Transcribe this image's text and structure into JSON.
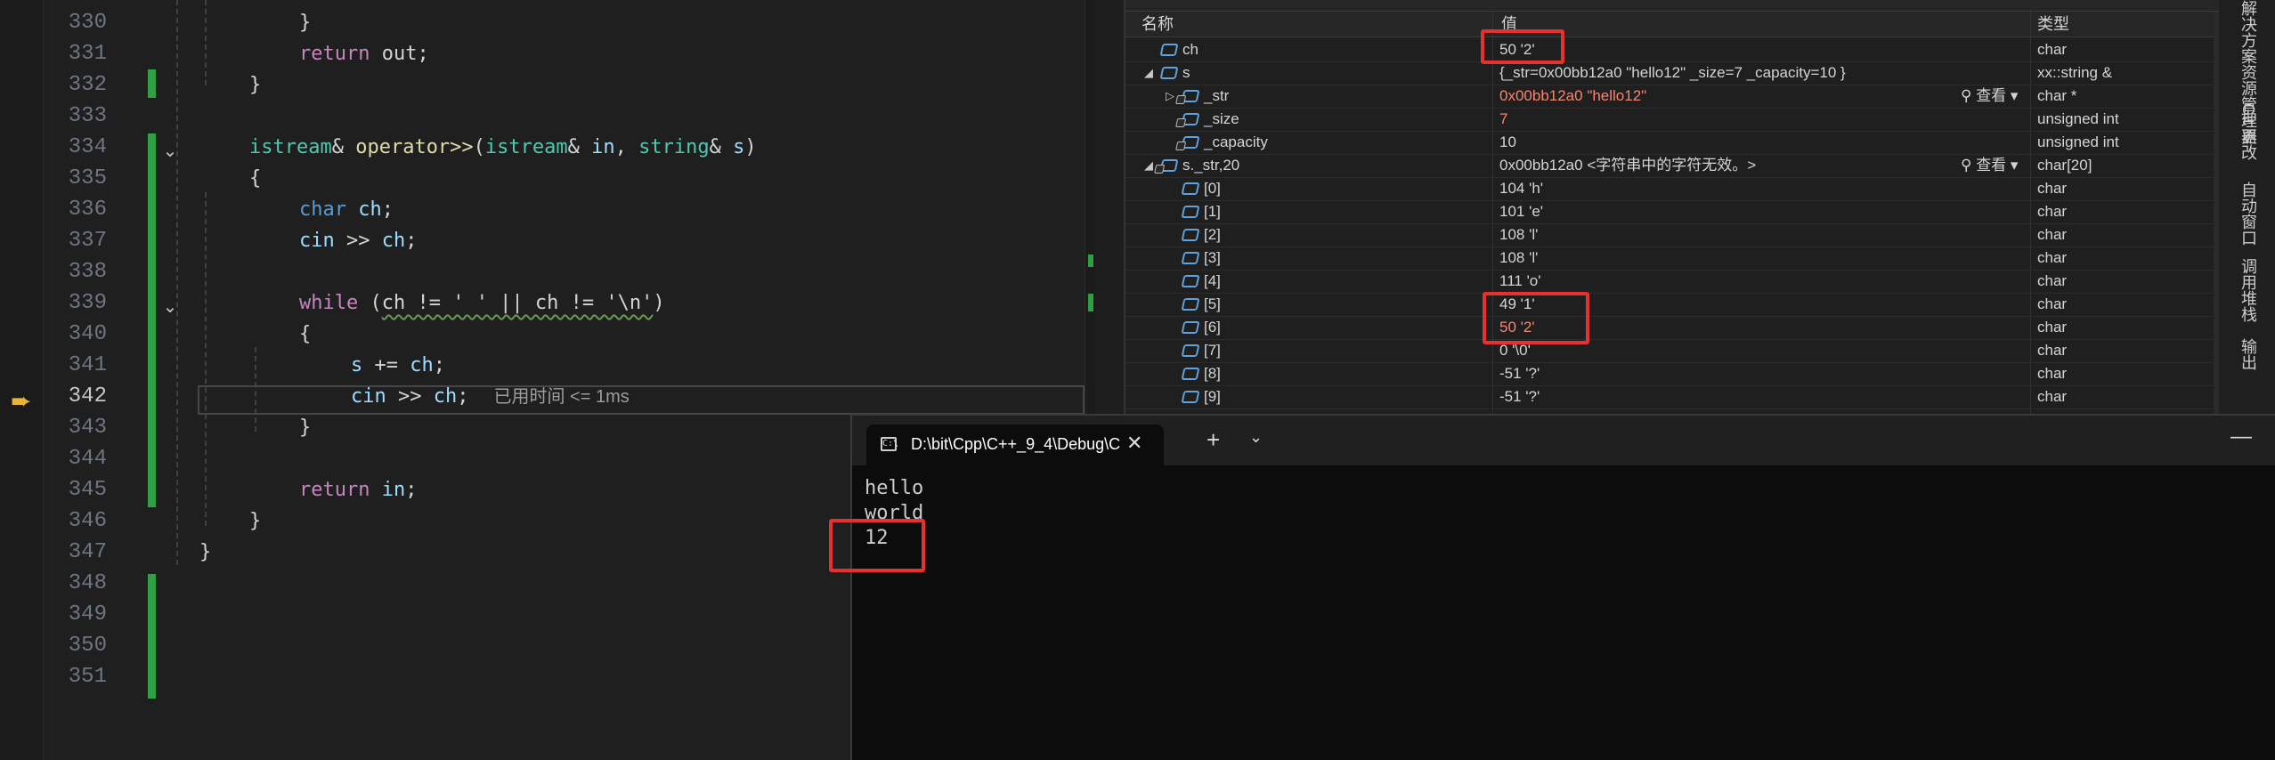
{
  "editor": {
    "lines": [
      {
        "num": "330",
        "tokens": [
          {
            "t": "}",
            "c": ""
          }
        ]
      },
      {
        "num": "331",
        "tokens": [
          {
            "t": "return",
            "c": "kw2"
          },
          {
            "t": " out;",
            "c": ""
          }
        ]
      },
      {
        "num": "332",
        "tokens": [
          {
            "t": "}",
            "c": ""
          }
        ]
      },
      {
        "num": "333",
        "tokens": []
      },
      {
        "num": "334",
        "tokens": [
          {
            "t": "istream",
            "c": "tp"
          },
          {
            "t": "& ",
            "c": ""
          },
          {
            "t": "operator>>",
            "c": "fn"
          },
          {
            "t": "(",
            "c": ""
          },
          {
            "t": "istream",
            "c": "tp"
          },
          {
            "t": "& ",
            "c": ""
          },
          {
            "t": "in",
            "c": "var"
          },
          {
            "t": ", ",
            "c": ""
          },
          {
            "t": "string",
            "c": "tp"
          },
          {
            "t": "& ",
            "c": ""
          },
          {
            "t": "s",
            "c": "var"
          },
          {
            "t": ")",
            "c": ""
          }
        ]
      },
      {
        "num": "335",
        "tokens": [
          {
            "t": "{",
            "c": ""
          }
        ]
      },
      {
        "num": "336",
        "tokens": [
          {
            "t": "char",
            "c": "kw"
          },
          {
            "t": " ",
            "c": ""
          },
          {
            "t": "ch",
            "c": "var"
          },
          {
            "t": ";",
            "c": ""
          }
        ]
      },
      {
        "num": "337",
        "tokens": [
          {
            "t": "cin",
            "c": "var"
          },
          {
            "t": " >> ",
            "c": ""
          },
          {
            "t": "ch",
            "c": "var"
          },
          {
            "t": ";",
            "c": ""
          }
        ]
      },
      {
        "num": "338",
        "tokens": []
      },
      {
        "num": "339",
        "tokens": [
          {
            "t": "while",
            "c": "kw2"
          },
          {
            "t": " (",
            "c": ""
          },
          {
            "t": "ch != ' ' || ch != '\\n'",
            "c": "squig"
          },
          {
            "t": ")",
            "c": ""
          }
        ]
      },
      {
        "num": "340",
        "tokens": [
          {
            "t": "{",
            "c": ""
          }
        ]
      },
      {
        "num": "341",
        "tokens": [
          {
            "t": "s",
            "c": "var"
          },
          {
            "t": " += ",
            "c": ""
          },
          {
            "t": "ch",
            "c": "var"
          },
          {
            "t": ";",
            "c": ""
          }
        ]
      },
      {
        "num": "342",
        "tokens": [
          {
            "t": "cin",
            "c": "var"
          },
          {
            "t": " >> ",
            "c": ""
          },
          {
            "t": "ch",
            "c": "var"
          },
          {
            "t": ";",
            "c": ""
          }
        ]
      },
      {
        "num": "343",
        "tokens": [
          {
            "t": "}",
            "c": ""
          }
        ]
      },
      {
        "num": "344",
        "tokens": []
      },
      {
        "num": "345",
        "tokens": [
          {
            "t": "return",
            "c": "kw2"
          },
          {
            "t": " ",
            "c": ""
          },
          {
            "t": "in",
            "c": "var"
          },
          {
            "t": ";",
            "c": ""
          }
        ]
      },
      {
        "num": "346",
        "tokens": [
          {
            "t": "}",
            "c": ""
          }
        ]
      },
      {
        "num": "347",
        "tokens": [
          {
            "t": "}",
            "c": ""
          }
        ]
      },
      {
        "num": "348",
        "tokens": []
      },
      {
        "num": "349",
        "tokens": []
      },
      {
        "num": "350",
        "tokens": []
      },
      {
        "num": "351",
        "tokens": []
      }
    ],
    "elapsed_hint": "已用时间 <= 1ms"
  },
  "watch": {
    "columns": {
      "name": "名称",
      "value": "值",
      "type": "类型"
    },
    "viewer_label": "查看",
    "rows": [
      {
        "name": "ch",
        "value": "50 '2'",
        "type": "char"
      },
      {
        "name": "s",
        "value": "{_str=0x00bb12a0 \"hello12\" _size=7 _capacity=10 }",
        "type": "xx::string &"
      },
      {
        "name": "_str",
        "value": "0x00bb12a0 \"hello12\"",
        "type": "char *"
      },
      {
        "name": "_size",
        "value": "7",
        "type": "unsigned int"
      },
      {
        "name": "_capacity",
        "value": "10",
        "type": "unsigned int"
      },
      {
        "name": "s._str,20",
        "value": "0x00bb12a0 <字符串中的字符无效。>",
        "type": "char[20]"
      },
      {
        "name": "[0]",
        "value": "104 'h'",
        "type": "char"
      },
      {
        "name": "[1]",
        "value": "101 'e'",
        "type": "char"
      },
      {
        "name": "[2]",
        "value": "108 'l'",
        "type": "char"
      },
      {
        "name": "[3]",
        "value": "108 'l'",
        "type": "char"
      },
      {
        "name": "[4]",
        "value": "111 'o'",
        "type": "char"
      },
      {
        "name": "[5]",
        "value": "49 '1'",
        "type": "char"
      },
      {
        "name": "[6]",
        "value": "50 '2'",
        "type": "char"
      },
      {
        "name": "[7]",
        "value": "0 '\\0'",
        "type": "char"
      },
      {
        "name": "[8]",
        "value": "-51 '?'",
        "type": "char"
      },
      {
        "name": "[9]",
        "value": "-51 '?'",
        "type": "char"
      }
    ]
  },
  "side_tabs": [
    "解决方案资源管理器",
    "Git 更改",
    "自动窗口",
    "调用堆栈",
    "输出"
  ],
  "terminal": {
    "tab_title": "D:\\bit\\Cpp\\C++_9_4\\Debug\\C",
    "icon_text": "C:\\",
    "close_glyph": "✕",
    "plus_glyph": "+",
    "dropdown_glyph": "⌄",
    "minimize_glyph": "—",
    "output": [
      "hello",
      "world",
      "12"
    ]
  },
  "colors": {
    "highlight": "#e5312f",
    "changebar": "#2ea043",
    "exec_arrow": "#e8b339"
  }
}
